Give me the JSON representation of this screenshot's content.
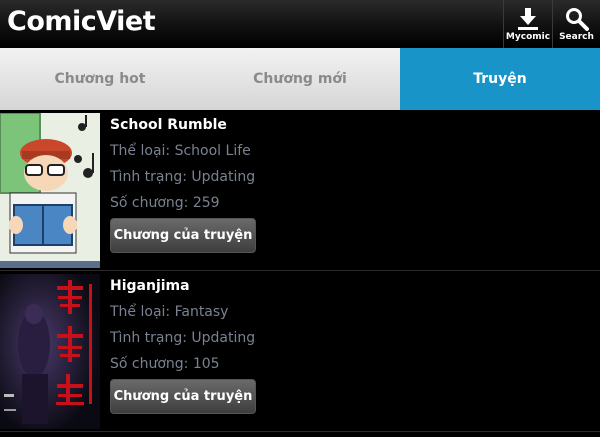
{
  "header": {
    "title": "ComicViet",
    "buttons": [
      {
        "label": "Mycomic",
        "icon": "download-icon"
      },
      {
        "label": "Search",
        "icon": "search-icon"
      }
    ]
  },
  "tabs": [
    {
      "label": "Chương hot",
      "active": false
    },
    {
      "label": "Chương mới",
      "active": false
    },
    {
      "label": "Truyện",
      "active": true
    }
  ],
  "comics": [
    {
      "title": "School Rumble",
      "genre_label": "Thể loại:",
      "genre": "School Life",
      "status_label": "Tình trạng:",
      "status": "Updating",
      "chapters_label": "Số chương:",
      "chapters": "259",
      "button": "Chương của truyện"
    },
    {
      "title": "Higanjima",
      "genre_label": "Thể loại:",
      "genre": "Fantasy",
      "status_label": "Tình trạng:",
      "status": "Updating",
      "chapters_label": "Số chương:",
      "chapters": "105",
      "button": "Chương của truyện"
    }
  ],
  "colors": {
    "accent": "#1894c8",
    "meta_text": "#7a8290",
    "tab_inactive_text": "#8a8a8a"
  }
}
